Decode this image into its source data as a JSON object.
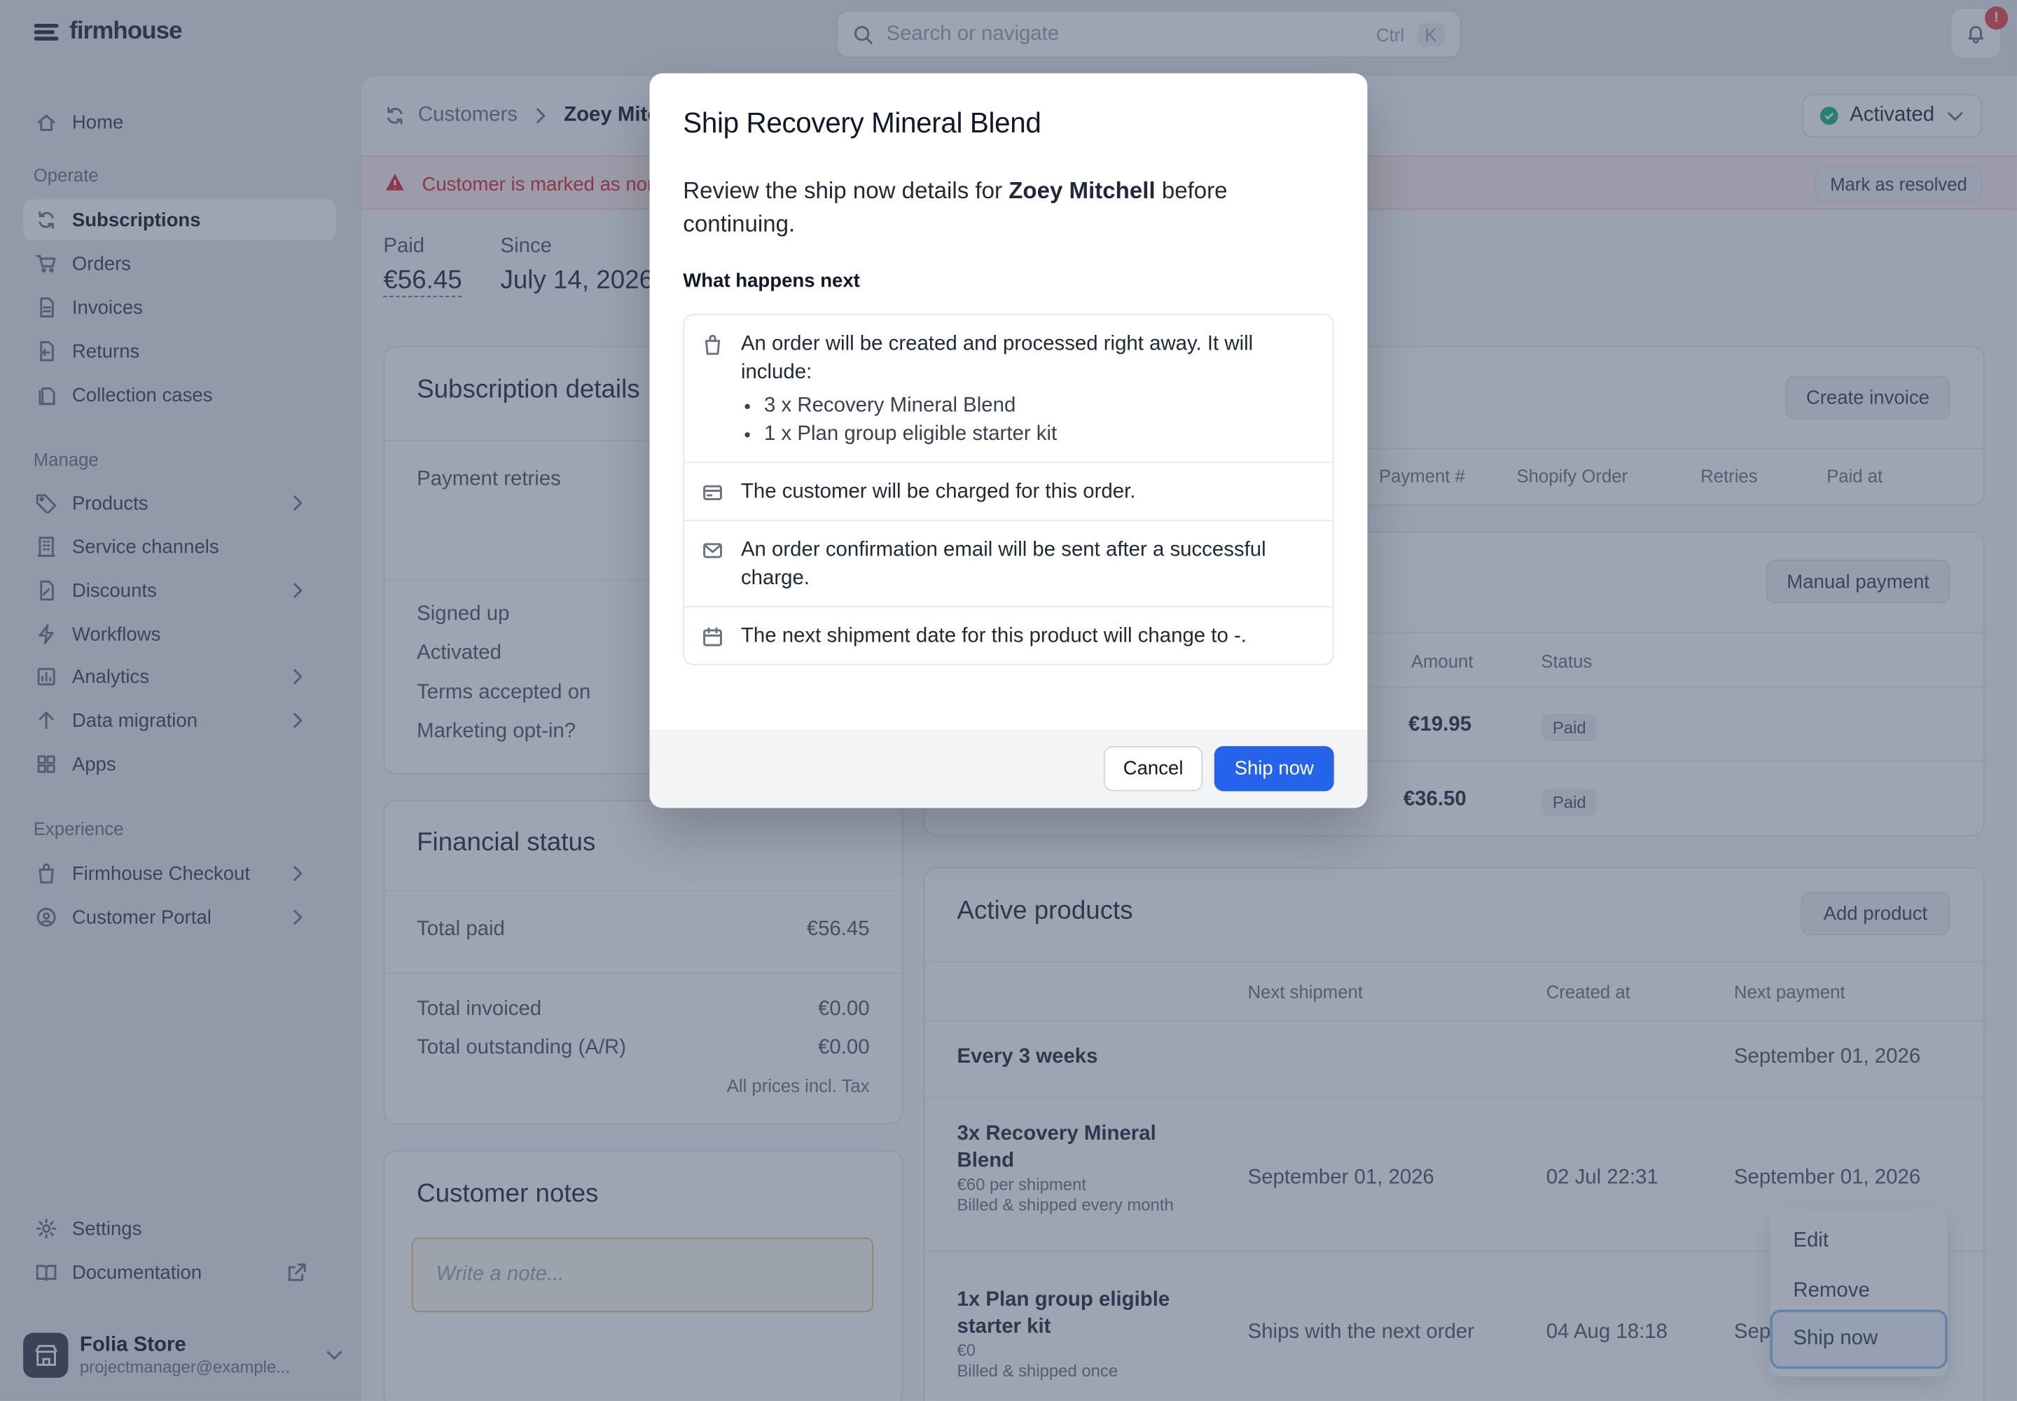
{
  "app": {
    "brand": "firmhouse"
  },
  "search": {
    "placeholder": "Search or navigate",
    "kbd1": "Ctrl",
    "kbd2": "K"
  },
  "notifications": {
    "badge": "!"
  },
  "sidebar": {
    "home": "Home",
    "operate": "Operate",
    "subscriptions": "Subscriptions",
    "orders": "Orders",
    "invoices": "Invoices",
    "returns": "Returns",
    "collection": "Collection cases",
    "manage": "Manage",
    "products": "Products",
    "service": "Service channels",
    "discounts": "Discounts",
    "workflows": "Workflows",
    "analytics": "Analytics",
    "migration": "Data migration",
    "apps": "Apps",
    "experience": "Experience",
    "checkout": "Firmhouse Checkout",
    "portal": "Customer Portal",
    "settings": "Settings",
    "documentation": "Documentation"
  },
  "account": {
    "name": "Folia Store",
    "email": "projectmanager@example..."
  },
  "header": {
    "crumb": "Customers",
    "customer": "Zoey Mitchell",
    "status": "Activated"
  },
  "alert": {
    "text": "Customer is marked as non-paying",
    "action": "Mark as resolved"
  },
  "stats": {
    "paid_label": "Paid",
    "paid_value": "€56.45",
    "since_label": "Since",
    "since_value": "July 14, 2026"
  },
  "subscription": {
    "title": "Subscription details",
    "retries": "Payment retries",
    "signed": "Signed up",
    "activated": "Activated",
    "terms": "Terms accepted on",
    "marketing": "Marketing opt-in?"
  },
  "financial": {
    "title": "Financial status",
    "paid_l": "Total paid",
    "paid_v": "€56.45",
    "inv_l": "Total invoiced",
    "inv_v": "€0.00",
    "out_l": "Total outstanding (A/R)",
    "out_v": "€0.00",
    "note": "All prices incl. Tax"
  },
  "notes": {
    "title": "Customer notes",
    "placeholder": "Write a note..."
  },
  "invoices": {
    "create": "Create invoice",
    "h_payment": "Payment #",
    "h_shopify": "Shopify Order",
    "h_retries": "Retries",
    "h_paid": "Paid at"
  },
  "payments": {
    "manual": "Manual payment",
    "h_amount": "Amount",
    "h_status": "Status",
    "rows": [
      {
        "amount": "€19.95",
        "status": "Paid"
      },
      {
        "amount": "€36.50",
        "status": "Paid"
      }
    ]
  },
  "products": {
    "title": "Active products",
    "add": "Add product",
    "h_next": "Next shipment",
    "h_created": "Created at",
    "h_payment": "Next payment",
    "group": "Every 3 weeks",
    "group_payment": "September 01, 2026",
    "items": [
      {
        "name": "3x Recovery Mineral Blend",
        "price": "€60 per shipment",
        "billing": "Billed & shipped every month",
        "next": "September 01, 2026",
        "created": "02 Jul 22:31",
        "payment": "September 01, 2026"
      },
      {
        "name": "1x Plan group eligible starter kit",
        "price": "€0",
        "billing": "Billed & shipped once",
        "next": "Ships with the next order",
        "created": "04 Aug 18:18",
        "payment": "Sep"
      }
    ]
  },
  "menu": {
    "edit": "Edit",
    "remove": "Remove",
    "ship": "Ship now"
  },
  "modal": {
    "title": "Ship Recovery Mineral Blend",
    "intro_a": "Review the ship now details for ",
    "intro_name": "Zoey Mitchell",
    "intro_b": " before continuing.",
    "next_heading": "What happens next",
    "step1": "An order will be created and processed right away. It will include:",
    "step1_items": [
      "3 x Recovery Mineral Blend",
      "1 x Plan group eligible starter kit"
    ],
    "step2": "The customer will be charged for this order.",
    "step3": "An order confirmation email will be sent after a successful charge.",
    "step4": "The next shipment date for this product will change to -.",
    "cancel": "Cancel",
    "confirm": "Ship now"
  },
  "colors": {
    "primary": "#2563eb",
    "danger": "#dc2626",
    "success": "#10b981",
    "overlay": "#3c4a66"
  }
}
